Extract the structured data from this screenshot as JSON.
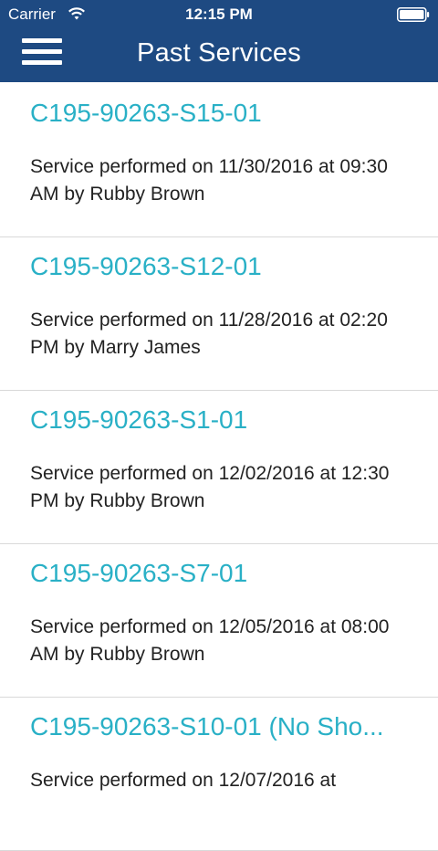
{
  "status_bar": {
    "carrier": "Carrier",
    "time": "12:15 PM",
    "icons": [
      "wifi-icon",
      "battery-icon"
    ]
  },
  "header": {
    "title": "Past Services",
    "menu_icon": "hamburger-icon",
    "background_color": "#1e4a82"
  },
  "services": [
    {
      "id": "C195-90263-S15-01",
      "description": "Service performed on 11/30/2016 at 09:30 AM by Rubby Brown"
    },
    {
      "id": "C195-90263-S12-01",
      "description": "Service performed on 11/28/2016 at 02:20 PM by Marry James"
    },
    {
      "id": "C195-90263-S1-01",
      "description": "Service performed on 12/02/2016 at 12:30 PM by Rubby Brown"
    },
    {
      "id": "C195-90263-S7-01",
      "description": "Service performed on 12/05/2016 at 08:00 AM by Rubby Brown"
    },
    {
      "id": "C195-90263-S10-01  (No Sho...",
      "description": "Service performed on 12/07/2016 at"
    }
  ],
  "colors": {
    "id_text": "#29b0c6",
    "body_text": "#222222",
    "divider": "#d9d9d9"
  }
}
